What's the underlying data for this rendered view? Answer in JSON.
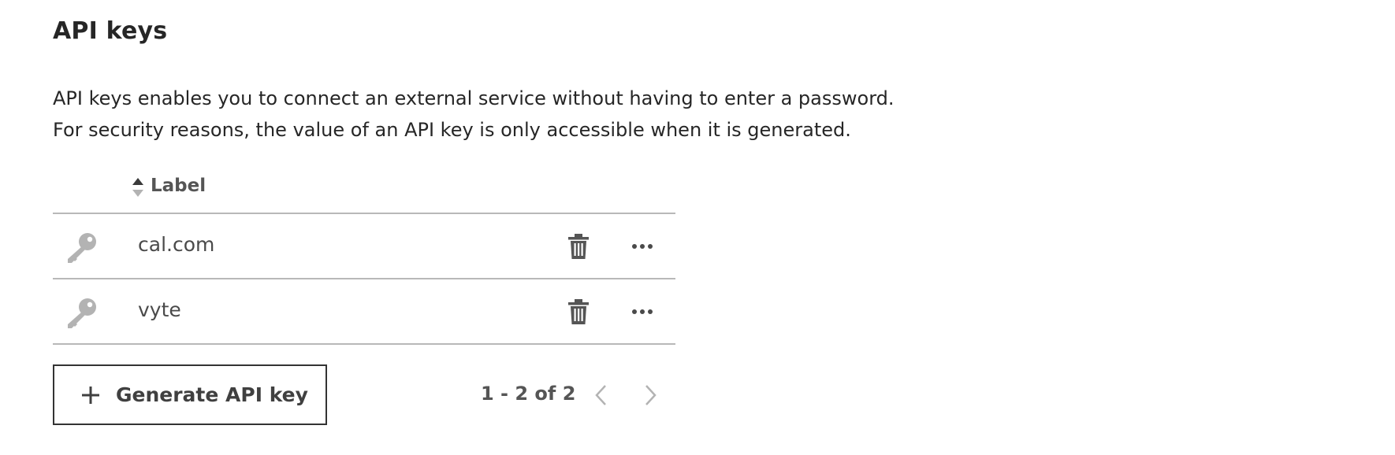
{
  "header": {
    "title": "API keys"
  },
  "description": {
    "line1": "API keys enables you to connect an external service without having to enter a password.",
    "line2": "For security reasons, the value of an API key is only accessible when it is generated."
  },
  "table": {
    "columns": [
      {
        "label": "Label",
        "sortable": true
      }
    ],
    "rows": [
      {
        "icon": "key-icon",
        "label": "cal.com"
      },
      {
        "icon": "key-icon",
        "label": "vyte"
      }
    ]
  },
  "actions": {
    "generate_label": "Generate API key"
  },
  "pagination": {
    "info": "1 - 2 of 2",
    "prev_disabled": true,
    "next_disabled": true
  },
  "colors": {
    "text": "#262626",
    "muted_text": "#555555",
    "icon_gray": "#b3b3b3",
    "divider": "#b8b8b8",
    "button_border": "#333333"
  }
}
